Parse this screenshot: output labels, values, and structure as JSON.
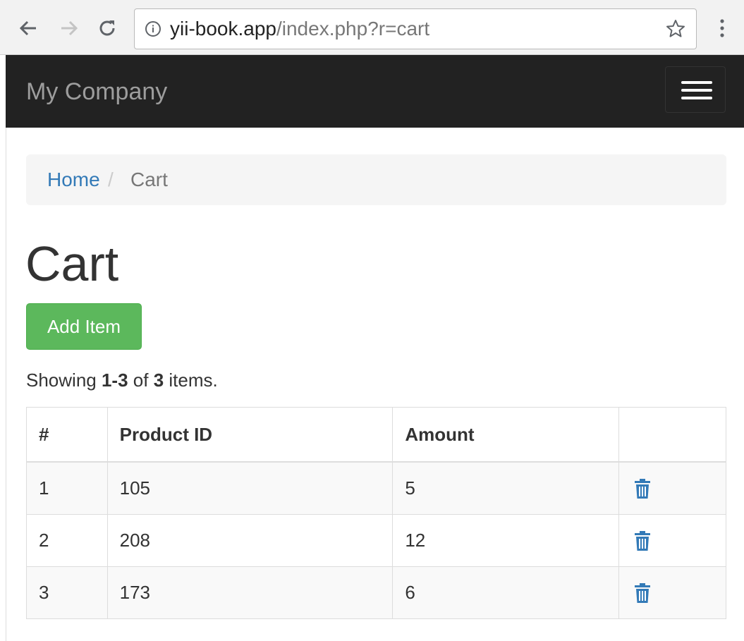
{
  "browser": {
    "url_host": "yii-book.app",
    "url_path": "/index.php?r=cart"
  },
  "navbar": {
    "brand": "My Company"
  },
  "breadcrumb": {
    "home": "Home",
    "separator": "/",
    "current": "Cart"
  },
  "page": {
    "title": "Cart",
    "add_button": "Add Item"
  },
  "summary": {
    "prefix": "Showing ",
    "range": "1-3",
    "middle": " of ",
    "total": "3",
    "suffix": " items."
  },
  "table": {
    "headers": [
      "#",
      "Product ID",
      "Amount",
      ""
    ],
    "rows": [
      {
        "num": "1",
        "product_id": "105",
        "amount": "5"
      },
      {
        "num": "2",
        "product_id": "208",
        "amount": "12"
      },
      {
        "num": "3",
        "product_id": "173",
        "amount": "6"
      }
    ]
  },
  "colors": {
    "navbar_bg": "#222222",
    "brand_text": "#9d9d9d",
    "link": "#337ab7",
    "success_button": "#5cb85c",
    "delete_icon": "#337ab7"
  },
  "icons": [
    "back-arrow-icon",
    "forward-arrow-icon",
    "reload-icon",
    "info-icon",
    "star-icon",
    "browser-menu-icon",
    "hamburger-menu-icon",
    "trash-icon"
  ]
}
